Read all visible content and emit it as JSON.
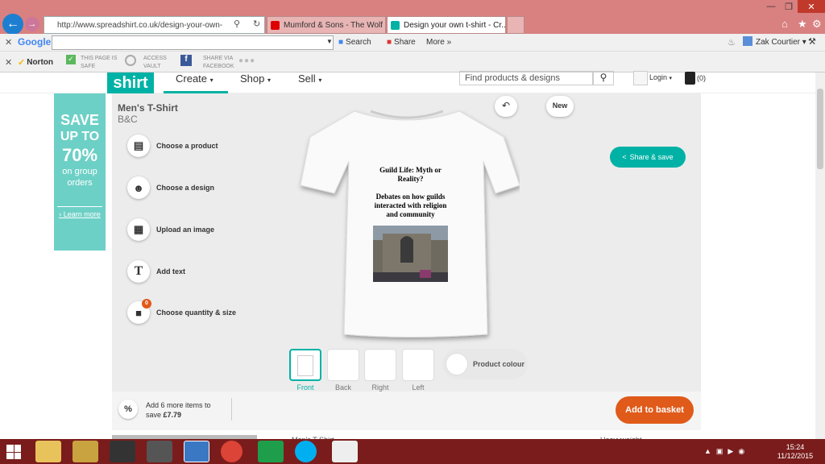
{
  "browser": {
    "url": "http://www.spreadshirt.co.uk/design-your-own-",
    "tabs": [
      {
        "label": "Mumford & Sons - The Wolf - ..."
      },
      {
        "label": "Design your own t-shirt - Cr..."
      }
    ]
  },
  "google_toolbar": {
    "brand": "Google",
    "search_label": "Search",
    "share_label": "Share",
    "more_label": "More",
    "user": "Zak Courtier"
  },
  "norton_toolbar": {
    "brand": "Norton",
    "safe_line1": "THIS PAGE IS",
    "safe_line2": "SAFE",
    "vault_line1": "ACCESS",
    "vault_line2": "VAULT",
    "share_line1": "SHARE VIA",
    "share_line2": "FACEBOOK"
  },
  "site": {
    "logo": "shirt",
    "menu": [
      "Create",
      "Shop",
      "Sell"
    ],
    "search_placeholder": "Find products & designs",
    "login": "Login",
    "basket_count": "(0)"
  },
  "promo": {
    "line1": "SAVE",
    "line2": "UP TO",
    "line3": "70%",
    "line4": "on group",
    "line5": "orders",
    "link": "Learn more"
  },
  "designer": {
    "product_title": "Men's T-Shirt",
    "product_brand": "B&C",
    "new_label": "New",
    "share_save": "Share & save",
    "tools": [
      {
        "label": "Choose a product"
      },
      {
        "label": "Choose a design"
      },
      {
        "label": "Upload an image"
      },
      {
        "label": "Add text"
      },
      {
        "label": "Choose quantity & size"
      }
    ],
    "qty_badge": "0",
    "design_text1": "Guild Life: Myth or Reality?",
    "design_text2": "Debates on how guilds interacted with religion and community",
    "views": [
      "Front",
      "Back",
      "Right",
      "Left"
    ],
    "product_colour": "Product colour"
  },
  "bottom": {
    "percent_icon": "%",
    "promo_line1": "Add 6 more items to",
    "promo_line2_prefix": "save ",
    "promo_amount": "£7.79",
    "add_to_basket": "Add to basket"
  },
  "below": {
    "text1": "Men's T-Shirt",
    "text2": "Heavyweight..."
  },
  "taskbar": {
    "time": "15:24",
    "date": "11/12/2015"
  },
  "colors": {
    "brand_teal": "#00b2a5",
    "cta_orange": "#e05a1a",
    "taskbar": "#7a1c1c"
  }
}
